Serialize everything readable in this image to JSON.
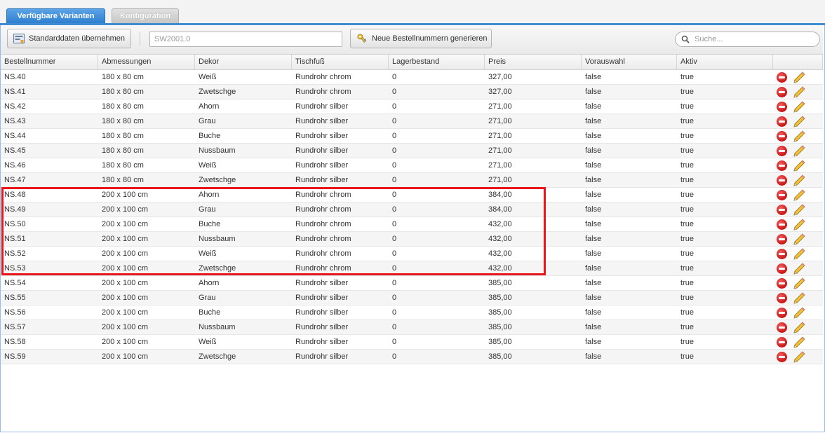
{
  "tabs": [
    {
      "label": "Verfügbare Varianten"
    },
    {
      "label": "Konfiguration"
    }
  ],
  "toolbar": {
    "apply_label": "Standarddaten übernehmen",
    "ordernumber_value": "SW2001.0",
    "generate_label": "Neue Bestellnummern generieren",
    "search_placeholder": "Suche..."
  },
  "columns": [
    "Bestellnummer",
    "Abmessungen",
    "Dekor",
    "Tischfuß",
    "Lagerbestand",
    "Preis",
    "Vorauswahl",
    "Aktiv"
  ],
  "rows": [
    [
      "NS.40",
      "180 x 80 cm",
      "Weiß",
      "Rundrohr chrom",
      "0",
      "327,00",
      "false",
      "true"
    ],
    [
      "NS.41",
      "180 x 80 cm",
      "Zwetschge",
      "Rundrohr chrom",
      "0",
      "327,00",
      "false",
      "true"
    ],
    [
      "NS.42",
      "180 x 80 cm",
      "Ahorn",
      "Rundrohr silber",
      "0",
      "271,00",
      "false",
      "true"
    ],
    [
      "NS.43",
      "180 x 80 cm",
      "Grau",
      "Rundrohr silber",
      "0",
      "271,00",
      "false",
      "true"
    ],
    [
      "NS.44",
      "180 x 80 cm",
      "Buche",
      "Rundrohr silber",
      "0",
      "271,00",
      "false",
      "true"
    ],
    [
      "NS.45",
      "180 x 80 cm",
      "Nussbaum",
      "Rundrohr silber",
      "0",
      "271,00",
      "false",
      "true"
    ],
    [
      "NS.46",
      "180 x 80 cm",
      "Weiß",
      "Rundrohr silber",
      "0",
      "271,00",
      "false",
      "true"
    ],
    [
      "NS.47",
      "180 x 80 cm",
      "Zwetschge",
      "Rundrohr silber",
      "0",
      "271,00",
      "false",
      "true"
    ],
    [
      "NS.48",
      "200 x 100 cm",
      "Ahorn",
      "Rundrohr chrom",
      "0",
      "384,00",
      "false",
      "true"
    ],
    [
      "NS.49",
      "200 x 100 cm",
      "Grau",
      "Rundrohr chrom",
      "0",
      "384,00",
      "false",
      "true"
    ],
    [
      "NS.50",
      "200 x 100 cm",
      "Buche",
      "Rundrohr chrom",
      "0",
      "432,00",
      "false",
      "true"
    ],
    [
      "NS.51",
      "200 x 100 cm",
      "Nussbaum",
      "Rundrohr chrom",
      "0",
      "432,00",
      "false",
      "true"
    ],
    [
      "NS.52",
      "200 x 100 cm",
      "Weiß",
      "Rundrohr chrom",
      "0",
      "432,00",
      "false",
      "true"
    ],
    [
      "NS.53",
      "200 x 100 cm",
      "Zwetschge",
      "Rundrohr chrom",
      "0",
      "432,00",
      "false",
      "true"
    ],
    [
      "NS.54",
      "200 x 100 cm",
      "Ahorn",
      "Rundrohr silber",
      "0",
      "385,00",
      "false",
      "true"
    ],
    [
      "NS.55",
      "200 x 100 cm",
      "Grau",
      "Rundrohr silber",
      "0",
      "385,00",
      "false",
      "true"
    ],
    [
      "NS.56",
      "200 x 100 cm",
      "Buche",
      "Rundrohr silber",
      "0",
      "385,00",
      "false",
      "true"
    ],
    [
      "NS.57",
      "200 x 100 cm",
      "Nussbaum",
      "Rundrohr silber",
      "0",
      "385,00",
      "false",
      "true"
    ],
    [
      "NS.58",
      "200 x 100 cm",
      "Weiß",
      "Rundrohr silber",
      "0",
      "385,00",
      "false",
      "true"
    ],
    [
      "NS.59",
      "200 x 100 cm",
      "Zwetschge",
      "Rundrohr silber",
      "0",
      "385,00",
      "false",
      "true"
    ]
  ],
  "row_actions": {
    "delete_icon": "delete-icon",
    "edit_icon": "pencil-icon"
  },
  "colors": {
    "accent": "#3e8bd1",
    "highlight": "#e8161b",
    "delete": "#c81414"
  }
}
